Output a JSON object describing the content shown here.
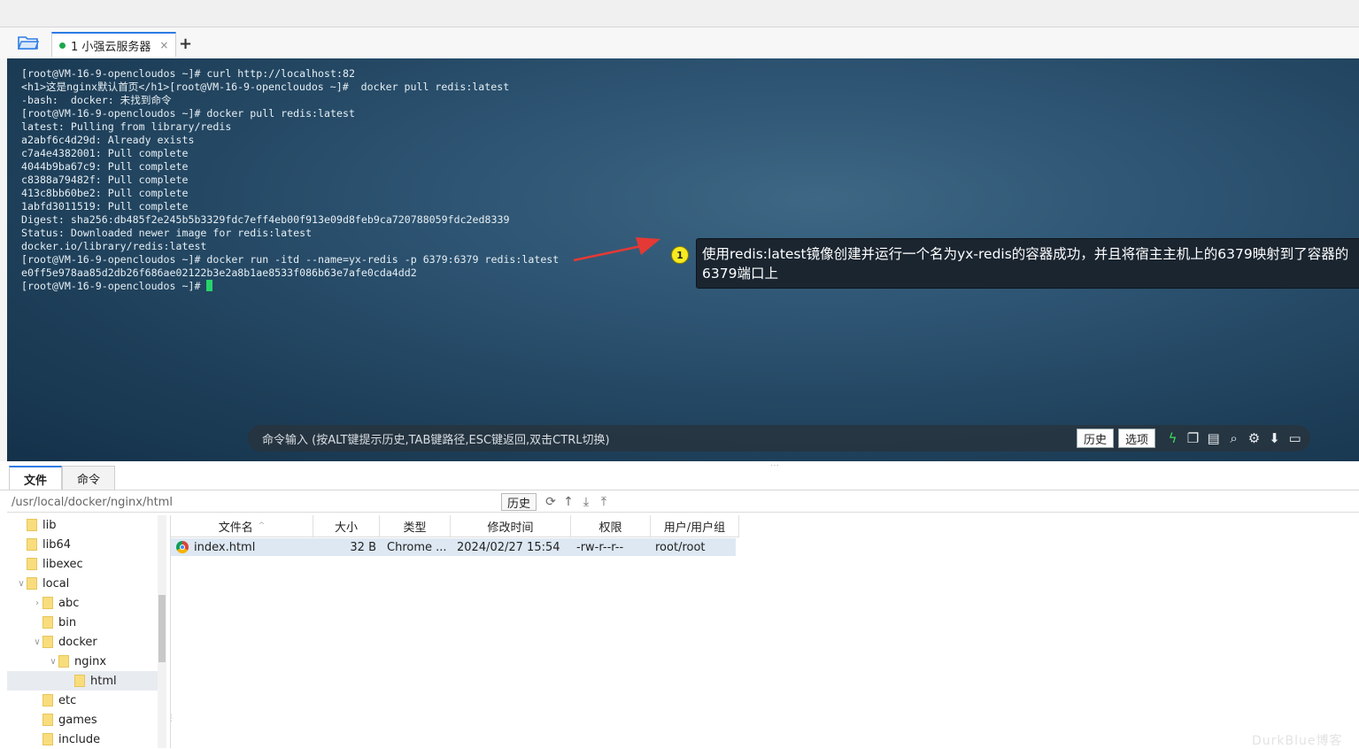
{
  "session_tab": {
    "label": "1 小强云服务器",
    "close": "×",
    "add": "+"
  },
  "terminal": {
    "lines": [
      "[root@VM-16-9-opencloudos ~]# curl http://localhost:82",
      "<h1>这是nginx默认首页</h1>[root@VM-16-9-opencloudos ~]#  docker pull redis:latest",
      "-bash:  docker: 未找到命令",
      "[root@VM-16-9-opencloudos ~]# docker pull redis:latest",
      "latest: Pulling from library/redis",
      "a2abf6c4d29d: Already exists",
      "c7a4e4382001: Pull complete",
      "4044b9ba67c9: Pull complete",
      "c8388a79482f: Pull complete",
      "413c8bb60be2: Pull complete",
      "1abfd3011519: Pull complete",
      "Digest: sha256:db485f2e245b5b3329fdc7eff4eb00f913e09d8feb9ca720788059fdc2ed8339",
      "Status: Downloaded newer image for redis:latest",
      "docker.io/library/redis:latest",
      "[root@VM-16-9-opencloudos ~]# docker run -itd --name=yx-redis -p 6379:6379 redis:latest",
      "e0ff5e978aa85d2db26f686ae02122b3e2a8b1ae8533f086b63e7afe0cda4dd2"
    ],
    "prompt": "[root@VM-16-9-opencloudos ~]# ",
    "cursor_color": "#27d36a"
  },
  "annotation": {
    "number": "1",
    "text": "使用redis:latest镜像创建并运行一个名为yx-redis的容器成功，并且将宿主主机上的6379映射到了容器的6379端口上",
    "arrow_color": "#e53935"
  },
  "command_bar": {
    "placeholder": "命令输入 (按ALT键提示历史,TAB键路径,ESC键返回,双击CTRL切换)",
    "history_label": "历史",
    "options_label": "选项"
  },
  "bottom_tabs": {
    "files": "文件",
    "commands": "命令"
  },
  "path_bar": {
    "path": "/usr/local/docker/nginx/html",
    "history_label": "历史"
  },
  "tree": [
    {
      "label": "lib",
      "depth": 0,
      "caret": ""
    },
    {
      "label": "lib64",
      "depth": 0,
      "caret": ""
    },
    {
      "label": "libexec",
      "depth": 0,
      "caret": ""
    },
    {
      "label": "local",
      "depth": 0,
      "caret": "∨"
    },
    {
      "label": "abc",
      "depth": 1,
      "caret": "›"
    },
    {
      "label": "bin",
      "depth": 1,
      "caret": ""
    },
    {
      "label": "docker",
      "depth": 1,
      "caret": "∨"
    },
    {
      "label": "nginx",
      "depth": 2,
      "caret": "∨"
    },
    {
      "label": "html",
      "depth": 3,
      "caret": ""
    },
    {
      "label": "etc",
      "depth": 1,
      "caret": ""
    },
    {
      "label": "games",
      "depth": 1,
      "caret": ""
    },
    {
      "label": "include",
      "depth": 1,
      "caret": ""
    }
  ],
  "file_table": {
    "headers": [
      "文件名",
      "大小",
      "类型",
      "修改时间",
      "权限",
      "用户/用户组"
    ],
    "sort_indicator": "^",
    "rows": [
      {
        "name": "index.html",
        "size": "32 B",
        "type": "Chrome ...",
        "modified": "2024/02/27 15:54",
        "perm": "-rw-r--r--",
        "owner": "root/root"
      }
    ]
  },
  "watermark": "DurkBlue博客"
}
